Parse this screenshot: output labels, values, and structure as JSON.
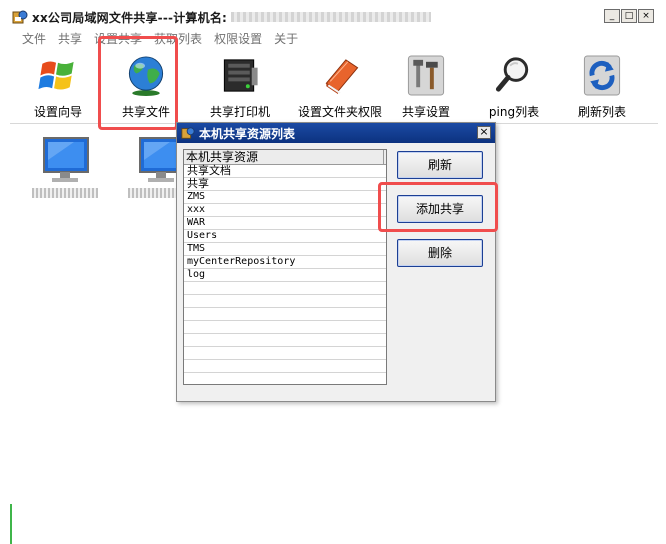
{
  "window": {
    "title": "xx公司局域网文件共享---计算机名:",
    "controls": {
      "minimize": "_",
      "maximize": "□",
      "close": "×"
    }
  },
  "menu": [
    "文件",
    "共享",
    "设置共享",
    "获取列表",
    "权限设置",
    "关于"
  ],
  "toolbar": [
    {
      "label": "设置向导",
      "icon": "windows-logo-icon"
    },
    {
      "label": "共享文件",
      "icon": "globe-icon"
    },
    {
      "label": "共享打印机",
      "icon": "printer-server-icon"
    },
    {
      "label": "设置文件夹权限",
      "icon": "folder-book-icon"
    },
    {
      "label": "共享设置",
      "icon": "tools-icon"
    },
    {
      "label": "ping列表",
      "icon": "magnifier-icon"
    },
    {
      "label": "刷新列表",
      "icon": "refresh-icon"
    }
  ],
  "dialog": {
    "title": "本机共享资源列表",
    "close": "×",
    "list_header": "本机共享资源",
    "items": [
      "共享文档",
      "共享",
      "ZMS",
      "xxx",
      "WAR",
      "Users",
      "TMS",
      "myCenterRepository",
      "log"
    ],
    "buttons": {
      "refresh": "刷新",
      "add_share": "添加共享",
      "delete": "删除"
    }
  },
  "colors": {
    "highlight": "#f04d4d",
    "dialog_title_bar": "#0c327f",
    "button_border": "#1c3f94"
  }
}
